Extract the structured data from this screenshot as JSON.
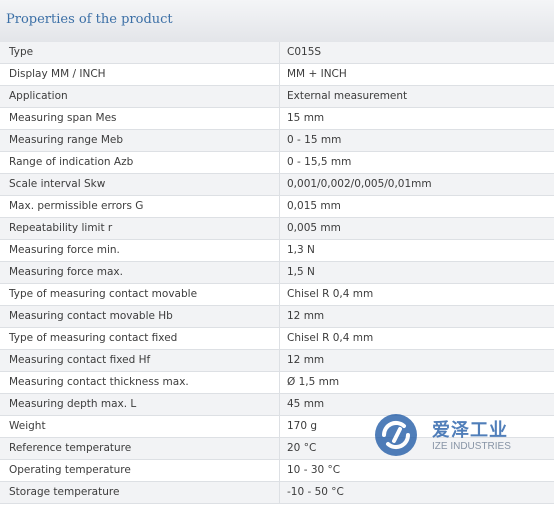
{
  "header": {
    "title": "Properties of the product"
  },
  "rows": [
    {
      "label": "Type",
      "value": "C015S"
    },
    {
      "label": "Display MM / INCH",
      "value": "MM + INCH"
    },
    {
      "label": "Application",
      "value": "External measurement"
    },
    {
      "label": "Measuring span Mes",
      "value": "15 mm"
    },
    {
      "label": "Measuring range Meb",
      "value": "0 - 15 mm"
    },
    {
      "label": "Range of indication Azb",
      "value": "0 - 15,5 mm"
    },
    {
      "label": "Scale interval Skw",
      "value": "0,001/0,002/0,005/0,01mm"
    },
    {
      "label": "Max. permissible errors G",
      "value": "0,015 mm"
    },
    {
      "label": "Repeatability limit r",
      "value": "0,005 mm"
    },
    {
      "label": "Measuring force min.",
      "value": "1,3 N"
    },
    {
      "label": "Measuring force max.",
      "value": "1,5 N"
    },
    {
      "label": "Type of measuring contact movable",
      "value": "Chisel R 0,4 mm"
    },
    {
      "label": "Measuring contact movable Hb",
      "value": "12 mm"
    },
    {
      "label": "Type of measuring contact fixed",
      "value": "Chisel R 0,4 mm"
    },
    {
      "label": "Measuring contact fixed Hf",
      "value": "12 mm"
    },
    {
      "label": "Measuring contact thickness max.",
      "value": "Ø 1,5 mm"
    },
    {
      "label": "Measuring depth max. L",
      "value": "45 mm"
    },
    {
      "label": "Weight",
      "value": "170 g"
    },
    {
      "label": "Reference temperature",
      "value": "20 °C"
    },
    {
      "label": "Operating temperature",
      "value": "10 - 30 °C"
    },
    {
      "label": "Storage temperature",
      "value": "-10 - 50 °C"
    }
  ],
  "watermark": {
    "chinese_text": "爱泽工业",
    "english_text": "IZE INDUSTRIES",
    "icon": "ize-logo-icon",
    "color": "#1f5aa6"
  }
}
